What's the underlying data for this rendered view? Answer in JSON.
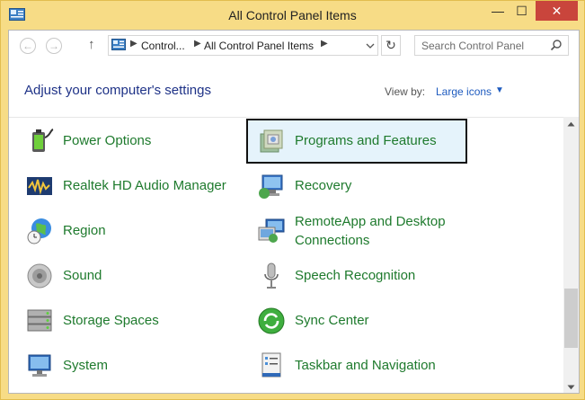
{
  "window": {
    "title": "All Control Panel Items"
  },
  "titlebar": {
    "min": "—",
    "max": "☐",
    "close": "✕"
  },
  "nav": {
    "back": "←",
    "forward": "→",
    "up": "↑",
    "breadcrumbs": [
      "Control...",
      "All Control Panel Items"
    ],
    "refresh": "↻",
    "search_placeholder": "Search Control Panel"
  },
  "header": {
    "title": "Adjust your computer's settings",
    "view_by_label": "View by:",
    "view_by_value": "Large icons"
  },
  "items": [
    {
      "label": "Power Options",
      "icon": "power-icon"
    },
    {
      "label": "Programs and Features",
      "icon": "programs-icon",
      "selected": true
    },
    {
      "label": "Realtek HD Audio Manager",
      "icon": "realtek-audio-icon"
    },
    {
      "label": "Recovery",
      "icon": "recovery-icon"
    },
    {
      "label": "Region",
      "icon": "region-icon"
    },
    {
      "label": "RemoteApp and Desktop Connections",
      "icon": "remoteapp-icon"
    },
    {
      "label": "Sound",
      "icon": "sound-icon"
    },
    {
      "label": "Speech Recognition",
      "icon": "microphone-icon"
    },
    {
      "label": "Storage Spaces",
      "icon": "storage-icon"
    },
    {
      "label": "Sync Center",
      "icon": "sync-icon"
    },
    {
      "label": "System",
      "icon": "system-icon"
    },
    {
      "label": "Taskbar and Navigation",
      "icon": "taskbar-icon"
    }
  ]
}
